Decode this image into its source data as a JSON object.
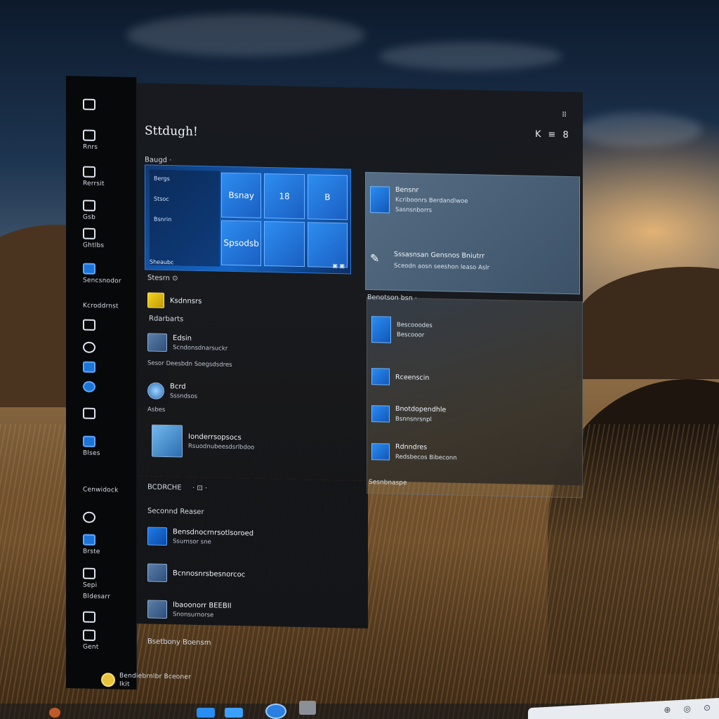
{
  "window": {
    "title": "Sttdugh!",
    "close_glyph": "⠿",
    "top_icons": [
      "K",
      "≡",
      "8"
    ]
  },
  "sidebar": {
    "items": [
      {
        "label": "",
        "icon": "chat-icon"
      },
      {
        "label": "Rnrs",
        "icon": "camera-icon"
      },
      {
        "label": "Rerrsit",
        "icon": "monitor-icon"
      },
      {
        "label": "Gsb",
        "icon": "calendar-icon"
      },
      {
        "label": "Ghtlbs",
        "icon": "settings-icon"
      },
      {
        "label": "Sencsnodor",
        "icon": "store-icon"
      },
      {
        "label": "Kcroddrnst",
        "icon": "grid-icon"
      },
      {
        "label": "",
        "icon": "clock-icon"
      },
      {
        "label": "",
        "icon": "user-icon"
      },
      {
        "label": "",
        "icon": "globe-icon"
      },
      {
        "label": "",
        "icon": "app-icon"
      },
      {
        "label": "Blses",
        "icon": "folder-icon"
      },
      {
        "label": "Cenwidock",
        "icon": "pin-icon"
      },
      {
        "label": "",
        "icon": "edge-icon"
      },
      {
        "label": "Brste",
        "icon": "mail-icon"
      },
      {
        "label": "Sepi",
        "icon": "code-icon"
      },
      {
        "label": "Bldesarr",
        "icon": "tool-icon"
      },
      {
        "label": "Gent",
        "icon": "lock-icon"
      }
    ],
    "user": {
      "name": "Bendiebrnlbr Bceoner",
      "sub": "Ikit"
    }
  },
  "main": {
    "section_top": "Baugd ·",
    "hero": {
      "left_rows": [
        "Bergs",
        "Stsoc",
        "Bsnrin"
      ],
      "tiles": [
        "Bsnay",
        "18",
        "B",
        "",
        "Spsodsb",
        ""
      ],
      "foot_left": "Sheaubc",
      "foot_right": "▣ ▣"
    },
    "section_2": "Stesrn ⊙",
    "list": [
      {
        "title": "Ksdnnsrs",
        "sub": "Rdarbarts"
      },
      {
        "title": "Edsin",
        "sub": "Scndonsdnarsuckr"
      },
      {
        "title": "Bcrd",
        "sub": "Sssndsos"
      },
      {
        "title": "Ionderrsopsocs",
        "sub": "Rsuodnubeesdsrlbdoo"
      }
    ],
    "row_text_1": "Sesor Deesbdn Soegsdsdres",
    "row_text_2": "Asbes",
    "section_3": "BCDRCHE",
    "section_3_right": "· ⊡ ·",
    "section_4": "Seconnd Reaser",
    "lower_list": [
      {
        "title": "Bensdnocrnrsotlsoroed",
        "sub": "Ssurnsor sne"
      },
      {
        "title": "Bcnnosnrsbesnorcoc",
        "sub": ""
      },
      {
        "title": "Ibaoonorr BEEBII",
        "sub": "Snonsurnorse"
      }
    ],
    "section_5": "Bsetbony Boensm"
  },
  "right_top": {
    "items": [
      {
        "title": "Bensnr",
        "sub": "Kcriboonrs Berdandlwoe",
        "sub2": "Sasnsnborrs"
      },
      {
        "title": "Sssasnsan Gensnos Bniutrr",
        "sub": "Sceodn aosn seeshon leaso Aslr"
      }
    ]
  },
  "right_bottom": {
    "header": "Benotson bsn ·",
    "items": [
      {
        "title": "Bescooodes",
        "sub": "Bescooor"
      },
      {
        "title": "Rceenscin",
        "sub": ""
      },
      {
        "title": "Bnotdopendhle",
        "sub": "Bsnnsnrsnpl"
      },
      {
        "title": "Rdnndres",
        "sub": "Redsbecos Bibeconn"
      },
      {
        "title": "Sesnbnaspe",
        "sub": ""
      }
    ]
  },
  "taskbar": {
    "search_glyphs": [
      "⊕",
      "◎",
      "⊙"
    ]
  }
}
